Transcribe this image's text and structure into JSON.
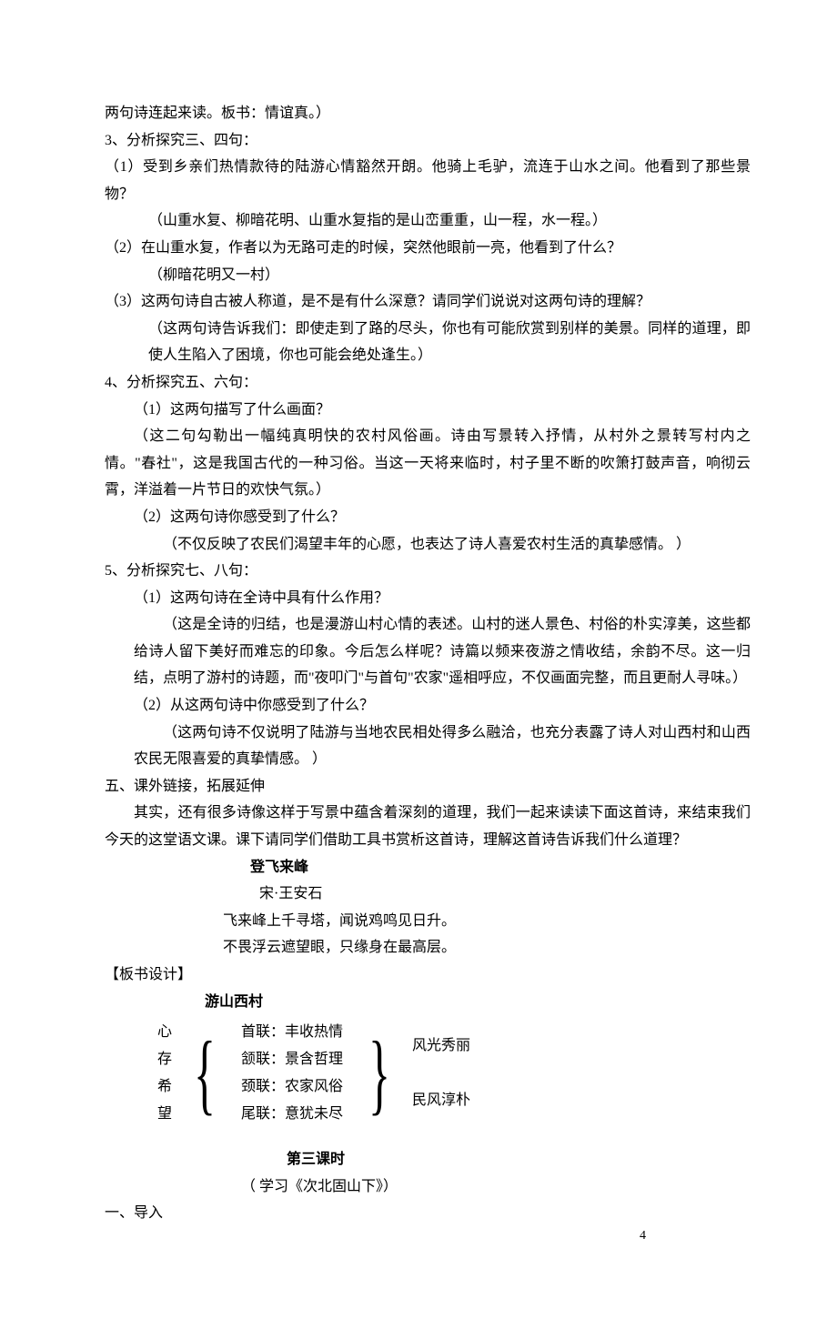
{
  "lines": {
    "l1": "两句诗连起来读。板书：情谊真。）",
    "l2": "3、分析探究三、四句：",
    "l3": "（1）受到乡亲们热情款待的陆游心情豁然开朗。他骑上毛驴，流连于山水之间。他看到了那些景物？",
    "l4": "（山重水复、柳暗花明、山重水复指的是山峦重重，山一程，水一程。）",
    "l5": "（2）在山重水复，作者以为无路可走的时候，突然他眼前一亮，他看到了什么？",
    "l6": "（柳暗花明又一村）",
    "l7": "（3）这两句诗自古被人称道，是不是有什么深意？请同学们说说对这两句诗的理解？",
    "l8": "（这两句诗告诉我们：即使走到了路的尽头，你也有可能欣赏到别样的美景。同样的道理，即使人生陷入了困境，你也可能会绝处逢生。）",
    "l9": "4、分析探究五、六句：",
    "l10": "（1）这两句描写了什么画面？",
    "l11": "（这二句勾勒出一幅纯真明快的农村风俗画。诗由写景转入抒情，从村外之景转写村内之情。\"春社\"，这是我国古代的一种习俗。当这一天将来临时，村子里不断的吹箫打鼓声音，响彻云霄，洋溢着一片节日的欢快气氛。）",
    "l12": "（2）这两句诗你感受到了什么？",
    "l13": "（不仅反映了农民们渴望丰年的心愿，也表达了诗人喜爱农村生活的真挚感情。 ）",
    "l14": "5、分析探究七、八句：",
    "l15": "（1）这两句诗在全诗中具有什么作用？",
    "l16": "（这是全诗的归结，也是漫游山村心情的表述。山村的迷人景色、村俗的朴实淳美，这些都给诗人留下美好而难忘的印象。今后怎么样呢？诗篇以频来夜游之情收结，余韵不尽。这一归结，点明了游村的诗题，而\"夜叩门\"与首句\"农家\"遥相呼应，不仅画面完整，而且更耐人寻味。）",
    "l17": "（2）从这两句诗中你感受到了什么？",
    "l18": "（这两句诗不仅说明了陆游与当地农民相处得多么融洽，也充分表露了诗人对山西村和山西农民无限喜爱的真挚情感。 ）",
    "l19": "五、课外链接，拓展延伸",
    "l20": "其实，还有很多诗像这样于写景中蕴含着深刻的道理，我们一起来读读下面这首诗，来结束我们今天的这堂语文课。课下请同学们借助工具书赏析这首诗，理解这首诗告诉我们什么道理？",
    "poem_title": "登飞来峰",
    "poem_author": "宋·王安石",
    "poem_l1": "飞来峰上千寻塔，闻说鸡鸣见日升。",
    "poem_l2": "不畏浮云遮望眼，只缘身在最高层。",
    "board_design": "【板书设计】",
    "board_title": "游山西村",
    "board_left": [
      "心",
      "存",
      "希",
      "望"
    ],
    "board_mid": [
      "首联：丰收热情",
      "颔联：景含哲理",
      "颈联：农家风俗",
      "尾联：意犹未尽"
    ],
    "board_right": [
      "风光秀丽",
      "民风淳朴"
    ],
    "lesson3_title": "第三课时",
    "lesson3_sub": "（ 学习《次北固山下》）",
    "l21": "一、导入"
  },
  "page_number": "4"
}
